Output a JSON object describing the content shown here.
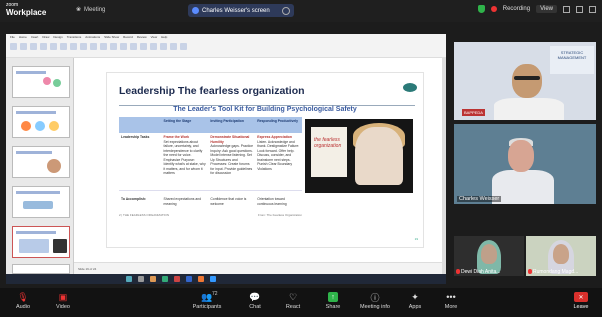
{
  "app": {
    "brand_top": "zoom",
    "brand_bottom": "Workplace"
  },
  "topbar": {
    "meeting_label": "Meeting",
    "share_title": "Charles Weisser's screen",
    "recording_label": "Recording",
    "view_label": "View"
  },
  "slide": {
    "title": "Leadership The fearless organization",
    "subtitle": "The Leader's Tool Kit for Building Psychological Safety",
    "columns": [
      "Setting the Stage",
      "Inviting Participation",
      "Responding Productively"
    ],
    "rows": [
      {
        "label": "Leadership Tasks",
        "cells": [
          {
            "head": "Frame the Work",
            "text": "Set expectations about failure, uncertainty, and interdependence to clarify the need for voice. Emphasize Purpose: Identify what's at stake, why it matters, and for whom it matters"
          },
          {
            "head": "Demonstrate Situational Humility",
            "text": "Acknowledge gaps. Practice Inquiry: Ask good questions. Model intense listening. Set Up Structures and Processes: Create forums for input. Provide guidelines for discussion"
          },
          {
            "head": "Express Appreciation",
            "text": "Listen. Acknowledge and thank. Destigmatize Failure: Look forward. Offer help. Discuss, consider, and brainstorm next steps. Punish Clear Boundary Violations"
          }
        ]
      },
      {
        "label": "To Accomplish:",
        "cells": [
          {
            "head": "",
            "text": "Shared expectations and meaning"
          },
          {
            "head": "",
            "text": "Confidence that voice is welcome"
          },
          {
            "head": "",
            "text": "Orientation toward continuous learning"
          }
        ]
      }
    ],
    "footer_left": "2 | THE FEARLESS ORGANIZATION",
    "footer_right": "From: The Fearless Organization",
    "book_title": "the fearless organization",
    "slide_number": "19"
  },
  "ppt": {
    "tabs": [
      "File",
      "Home",
      "Insert",
      "Draw",
      "Design",
      "Transitions",
      "Animations",
      "Slide Show",
      "Record",
      "Review",
      "View",
      "Help"
    ],
    "status": "Slide 19 of 24"
  },
  "participants_video": [
    {
      "name": "",
      "label": "BAPPEDA"
    },
    {
      "name": "Charles Weisser"
    },
    {
      "name": "Dewi Diah Anita..."
    },
    {
      "name": "Rumondang Magd..."
    }
  ],
  "toolbar": {
    "audio": "Audio",
    "video": "Video",
    "participants": "Participants",
    "participants_count": "72",
    "chat": "Chat",
    "react": "React",
    "share": "Share",
    "meeting_info": "Meeting info",
    "apps": "Apps",
    "more": "More",
    "leave": "Leave"
  }
}
